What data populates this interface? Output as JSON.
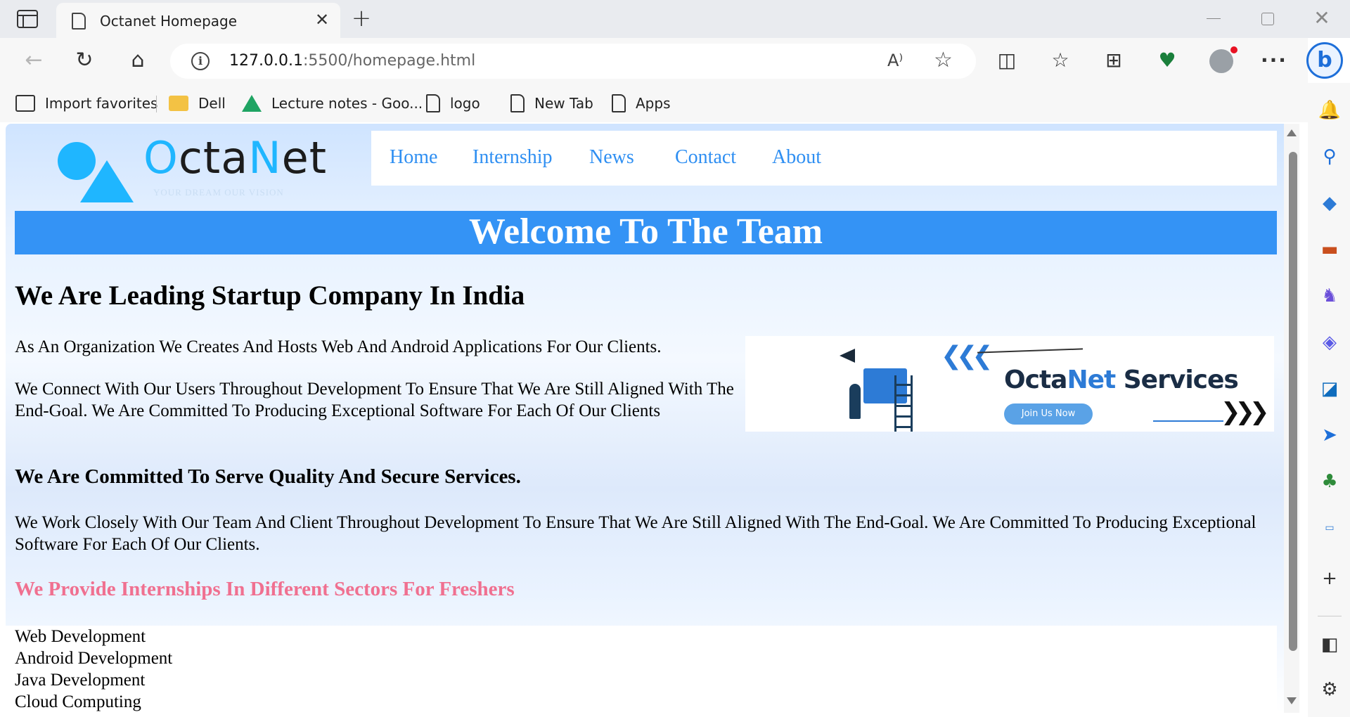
{
  "browser": {
    "tab_title": "Octanet Homepage",
    "tab_close_glyph": "✕",
    "new_tab_glyph": "+",
    "url_host": "127.0.0.1",
    "url_path": ":5500/homepage.html",
    "bookmarks": [
      {
        "label": "Import favorites",
        "icon": "import-icon"
      },
      {
        "label": "Dell",
        "icon": "folder-icon"
      },
      {
        "label": "Lecture notes - Goo...",
        "icon": "google-drive-icon"
      },
      {
        "label": "logo",
        "icon": "page-icon"
      },
      {
        "label": "New Tab",
        "icon": "page-icon"
      },
      {
        "label": "Apps",
        "icon": "page-icon"
      }
    ]
  },
  "site": {
    "logo_text_o": "O",
    "logo_text_cta": "cta",
    "logo_text_n": "N",
    "logo_text_et": "et",
    "logo_tagline": "YOUR DREAM OUR VISION",
    "nav": [
      "Home",
      "Internship",
      "News",
      "Contact",
      "About"
    ],
    "welcome": "Welcome To The Team",
    "heading_leading": "We Are Leading Startup Company In India",
    "para_1": "As An Organization We Creates And Hosts Web And Android Applications For Our Clients.",
    "para_2": "We Connect With Our Users Throughout Development To Ensure That We Are Still Aligned With The End-Goal. We Are Committed To Producing Exceptional Software For Each Of Our Clients",
    "banner": {
      "title_part1": "Octa",
      "title_part2": "Net",
      "title_part3": " Services",
      "button": "Join Us Now"
    },
    "heading_committed": "We Are Committed To Serve Quality And Secure Services.",
    "para_3": "We Work Closely With Our Team And Client Throughout Development To Ensure That We Are Still Aligned With The End-Goal. We Are Committed To Producing Exceptional Software For Each Of Our Clients.",
    "heading_internships": "We Provide Internships In Different Sectors For Freshers",
    "sectors": [
      "Web Development",
      "Android Development",
      "Java Development",
      "Cloud Computing"
    ]
  },
  "colors": {
    "nav_link": "#2f8ff2",
    "welcome_bg": "#3493f5",
    "internship_heading": "#f07090",
    "logo_accent": "#1fb6ff"
  }
}
